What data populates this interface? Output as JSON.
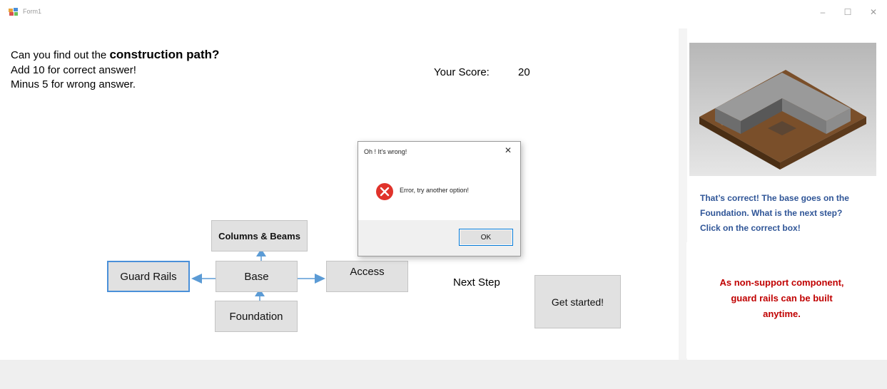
{
  "window": {
    "title": "Form1",
    "minimize": "–",
    "maximize": "☐",
    "close": "✕"
  },
  "intro": {
    "line1_prefix": "Can you find out the",
    "line1_emphasis": "construction path?",
    "line2": "Add 10 for correct answer!",
    "line3": "Minus 5 for wrong answer."
  },
  "score": {
    "label": "Your Score:",
    "value": "20"
  },
  "diagram": {
    "columns_beams": "Columns & Beams",
    "guard_rails": "Guard Rails",
    "base": "Base",
    "access": "Access",
    "foundation": "Foundation"
  },
  "next_step": {
    "label": "Next Step",
    "button": "Get started!"
  },
  "sidebar": {
    "correct_lines": [
      "That’s correct! The base goes on the",
      "Foundation. What is the next step?",
      "Click on the correct box!"
    ],
    "feedback_lines": [
      "As non-support component,",
      "guard rails can be built",
      "anytime."
    ]
  },
  "dialog": {
    "title": "Oh ! It's wrong!",
    "message": "Error, try another option!",
    "ok": "OK",
    "close": "✕"
  },
  "colors": {
    "accent_blue": "#4a90d9",
    "info_blue": "#2f5597",
    "feedback_red": "#c00000",
    "error_icon": "#e0332b"
  },
  "icons": {
    "app": "app-icon",
    "error": "error-icon",
    "arrows": "arrow-icon"
  }
}
